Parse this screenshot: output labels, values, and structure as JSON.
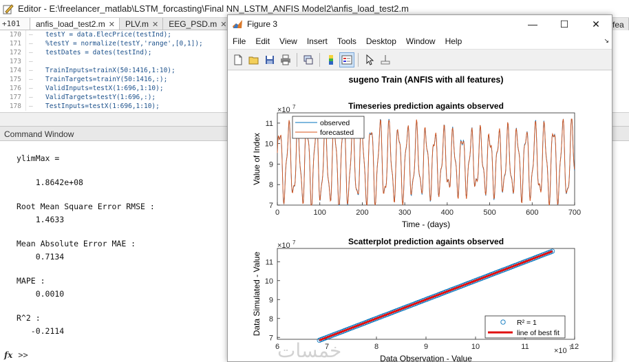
{
  "editor": {
    "title": "Editor - E:\\freelancer_matlab\\LSTM_forcasting\\Final NN_LSTM_ANFIS Model2\\anfis_load_test2.m",
    "line_indicator": "+101",
    "tabs": [
      "anfis_load_test2.m",
      "PLV.m",
      "EEG_PSD.m"
    ],
    "far_tab": "fea",
    "code": [
      {
        "ln": "170",
        "text": "testY = data.ElecPrice(testInd);"
      },
      {
        "ln": "171",
        "text": "%testY = normalize(testY,'range',[0,1]);"
      },
      {
        "ln": "172",
        "text": "testDates = dates(testInd);"
      },
      {
        "ln": "173",
        "text": ""
      },
      {
        "ln": "174",
        "text": "TrainInputs=trainX(50:1416,1:10);"
      },
      {
        "ln": "175",
        "text": "TrainTargets=trainY(50:1416,:);"
      },
      {
        "ln": "176",
        "text": "ValidInputs=testX(1:696,1:10);"
      },
      {
        "ln": "177",
        "text": "ValidTargets=testY(1:696,:);"
      },
      {
        "ln": "178",
        "text": "TestInputs=testX(1:696,1:10);"
      }
    ]
  },
  "command_window": {
    "title": "Command Window",
    "lines": [
      "ylimMax =",
      "    1.8642e+08",
      "Root Mean Square Error RMSE :",
      "    1.4633",
      "Mean Absolute Error MAE :",
      "    0.7134",
      "MAPE :",
      "    0.0010",
      "R^2 :",
      "   -0.2114"
    ],
    "prompt": ">>",
    "fx": "fx"
  },
  "figure": {
    "title": "Figure 3",
    "menu": [
      "File",
      "Edit",
      "View",
      "Insert",
      "Tools",
      "Desktop",
      "Window",
      "Help"
    ],
    "corner_glyph": "↘",
    "window_buttons": [
      "—",
      "☐",
      "✕"
    ],
    "toolbar_icons": [
      "new-figure-icon",
      "open-icon",
      "save-icon",
      "print-icon",
      "link-icon",
      "colorbar-icon",
      "legend-icon",
      "pointer-icon",
      "data-cursor-icon"
    ],
    "watermark": "خمسات",
    "suptitle": "sugeno Train (ANFIS with all features)"
  },
  "chart_data": [
    {
      "type": "line",
      "title": "Timeseries prediction againts observed",
      "xlabel": "Time - (days)",
      "ylabel": "Value of Index",
      "exponent": "×10",
      "exponent_power": "7",
      "xlim": [
        0,
        700
      ],
      "ylim": [
        7,
        11.5
      ],
      "xticks": [
        "0",
        "100",
        "200",
        "300",
        "400",
        "500",
        "600",
        "700"
      ],
      "yticks": [
        "7",
        "8",
        "9",
        "10",
        "11"
      ],
      "legend": "top-left",
      "series": [
        {
          "name": "observed",
          "color": "#0072bd",
          "period_days": 21.5,
          "min": 7.0,
          "max": 11.2
        },
        {
          "name": "forecasted",
          "color": "#d95319",
          "period_days": 21.5,
          "min": 7.0,
          "max": 11.2
        }
      ]
    },
    {
      "type": "scatter",
      "title": "Scatterplot prediction againts observed",
      "xlabel": "Data Observation - Value",
      "ylabel": "Data Simulated - Value",
      "exponent": "×10",
      "exponent_power": "7",
      "xlim": [
        6,
        12
      ],
      "ylim": [
        6.9,
        11.7
      ],
      "xticks": [
        "6",
        "7",
        "8",
        "9",
        "10",
        "11",
        "12"
      ],
      "yticks": [
        "7",
        "8",
        "9",
        "10",
        "11"
      ],
      "legend": "bottom-right",
      "series": [
        {
          "name": "R² = 1",
          "color": "#0072bd",
          "x_range": [
            6.85,
            11.55
          ]
        },
        {
          "name": "line of best fit",
          "color": "#e01010",
          "x_range": [
            6.85,
            11.55
          ]
        }
      ],
      "axis_end_x": "×10",
      "axis_end_x_power": "7"
    }
  ]
}
